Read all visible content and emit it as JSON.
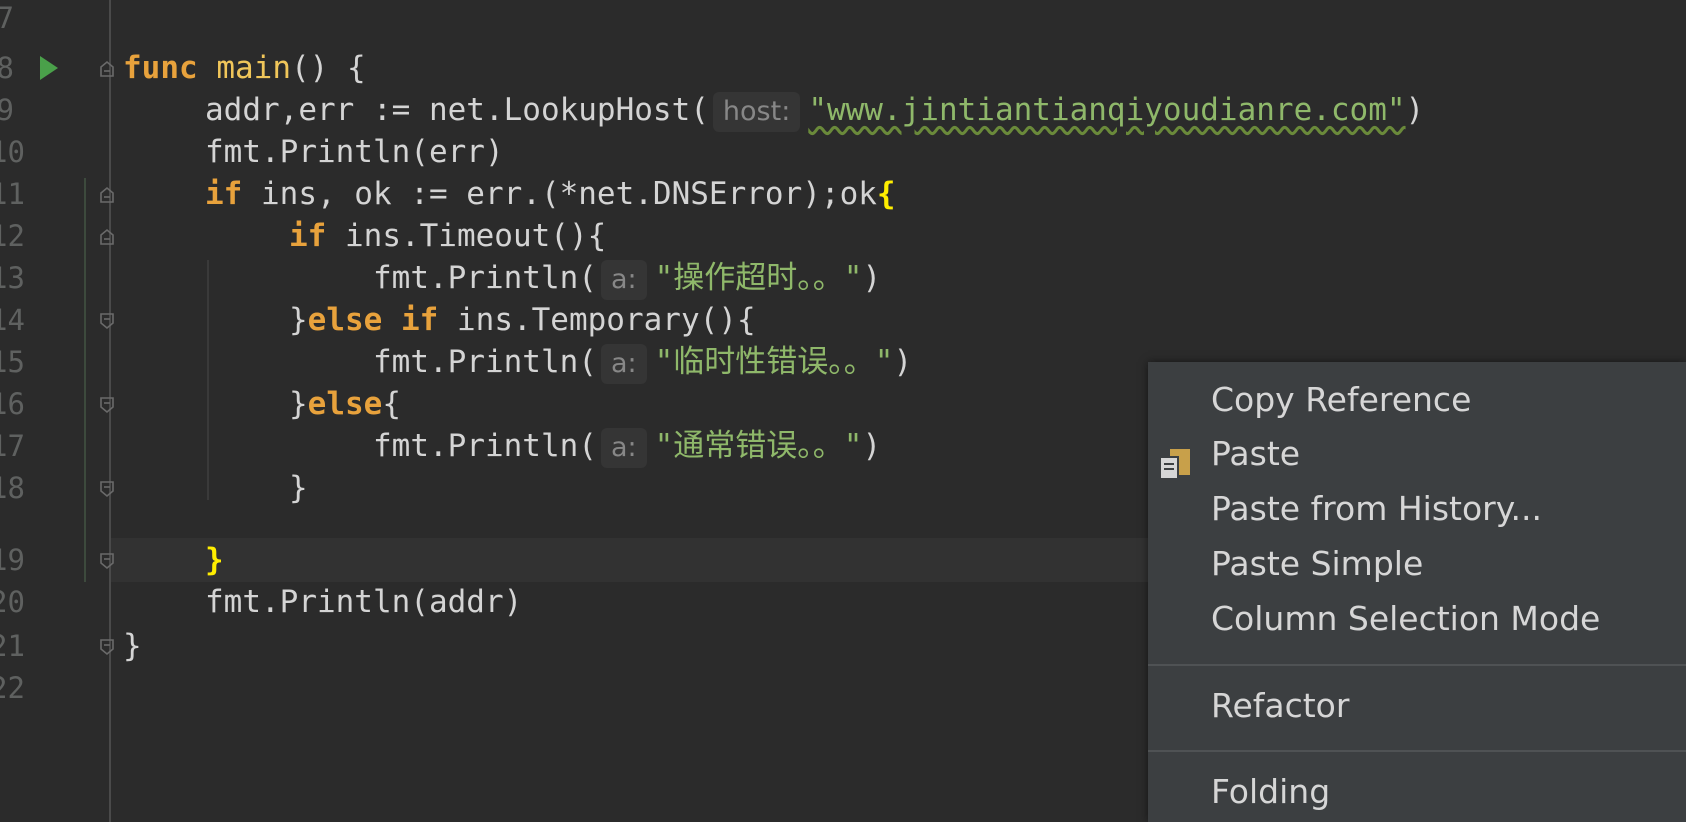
{
  "editor": {
    "line_numbers": [
      "7",
      "8",
      "9",
      "10",
      "11",
      "12",
      "13",
      "14",
      "15",
      "16",
      "17",
      "18",
      "19",
      "20",
      "21",
      "22"
    ],
    "lines": {
      "l8": {
        "kw": "func",
        "fn": "main",
        "rest": "() {"
      },
      "l9": {
        "pre": "addr,err := net.LookupHost(",
        "hint": "host:",
        "str": "\"www.jintiantianqiyoudianre.com\"",
        "post": ")"
      },
      "l10": {
        "text": "fmt.Println(err)"
      },
      "l11": {
        "kw": "if",
        "mid": " ins, ok := err.(*net.DNSError);ok",
        "brace": "{"
      },
      "l12": {
        "kw": "if",
        "rest": " ins.Timeout(){"
      },
      "l13": {
        "pre": "fmt.Println(",
        "hint": "a:",
        "str": "\"操作超时。。\"",
        "post": ")"
      },
      "l14": {
        "open": "}",
        "kw1": "else",
        "kw2": "if",
        "rest": " ins.Temporary(){"
      },
      "l15": {
        "pre": "fmt.Println(",
        "hint": "a:",
        "str": "\"临时性错误。。\"",
        "post": ")"
      },
      "l16": {
        "open": "}",
        "kw": "else",
        "rest": "{"
      },
      "l17": {
        "pre": "fmt.Println(",
        "hint": "a:",
        "str": "\"通常错误。。\"",
        "post": ")"
      },
      "l18": {
        "text": "}"
      },
      "l19": {
        "brace": "}"
      },
      "l20": {
        "text": "fmt.Println(addr)"
      },
      "l21": {
        "text": "}"
      }
    }
  },
  "context_menu": {
    "items": [
      {
        "label": "Copy Reference"
      },
      {
        "label": "Paste",
        "icon": "paste-icon"
      },
      {
        "label": "Paste from History..."
      },
      {
        "label": "Paste Simple"
      },
      {
        "label": "Column Selection Mode"
      },
      {
        "label": "Refactor"
      },
      {
        "label": "Folding"
      }
    ]
  },
  "colors": {
    "background": "#2b2b2b",
    "keyword": "#e8a23c",
    "string": "#8fb86a",
    "menu_background": "#3c3f41",
    "run_icon": "#4aa04a"
  }
}
